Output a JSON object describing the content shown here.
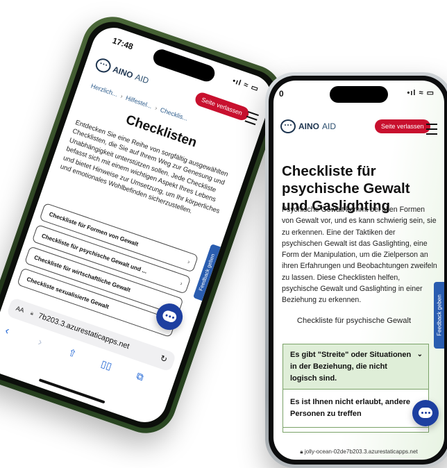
{
  "phone_left": {
    "status": {
      "time": "17:48",
      "indicators": "•ıl ≈ ▭"
    },
    "header": {
      "logo_bold": "AINO",
      "logo_light": "AID",
      "exit_button": "Seite verlassen"
    },
    "breadcrumb": [
      "Herzlich...",
      "Hilfestel...",
      "Checklis..."
    ],
    "title": "Checklisten",
    "intro": "Entdecken Sie eine Reihe von sorgfältig ausgewählten Checklisten, die Sie auf Ihrem Weg zur Genesung und Unabhängigkeit unterstützen sollen. Jede Checkliste befasst sich mit einem wichtigen Aspekt Ihres Lebens und bietet Hinweise zur Umsetzung, um Ihr körperliches und emotionales Wohlbefinden sicherzustellen.",
    "checklists": [
      "Checkliste für Formen von Gewalt",
      "Checkliste für psychische Gewalt und ...",
      "Checkliste für wirtschaftliche Gewalt",
      "Checkliste sexualisierte Gewalt"
    ],
    "feedback": "Feedback geben",
    "urlbar": {
      "aa": "AA",
      "address": "7b203.3.azurestaticapps.net"
    }
  },
  "phone_right": {
    "status": {
      "time": "0",
      "indicators": "•ıl ≈ ▭"
    },
    "header": {
      "logo_bold": "AINO",
      "logo_light": "AID",
      "exit_button": "Seite verlassen"
    },
    "title": "Checkliste für psychische Gewalt und Gaslighting",
    "body": "Psychische Gewalt kommt bei allen Formen von Gewalt vor, und es kann schwierig sein, sie zu erkennen. Eine der Taktiken der psychischen Gewalt ist das Gaslighting, eine Form der Manipulation, um die Zielperson an ihren Erfahrungen und Beobachtungen zweifeln zu lassen. Diese Checklisten helfen, psychische Gewalt und Gaslighting in einer Beziehung zu erkennen.",
    "subtitle": "Checkliste für psychische Gewalt",
    "accordion": [
      "Es gibt \"Streite\" oder Situationen in der Beziehung, die nicht logisch sind.",
      "Es ist Ihnen nicht erlaubt, andere Personen zu treffen"
    ],
    "feedback": "Feedback geben",
    "url": "jolly-ocean-02de7b203.3.azurestaticapps.net"
  },
  "icons": [
    "chevron-right-icon",
    "chevron-down-icon",
    "chat-icon",
    "menu-icon",
    "lock-icon",
    "reload-icon",
    "share-icon",
    "bookmarks-icon",
    "tabs-icon",
    "back-icon",
    "forward-icon"
  ],
  "colors": {
    "exit_red": "#c8102e",
    "feedback_blue": "#2a5db0",
    "chat_blue": "#1d3fa0",
    "accordion_green": "#dfeed8",
    "frame_green": "#2c4a24"
  }
}
